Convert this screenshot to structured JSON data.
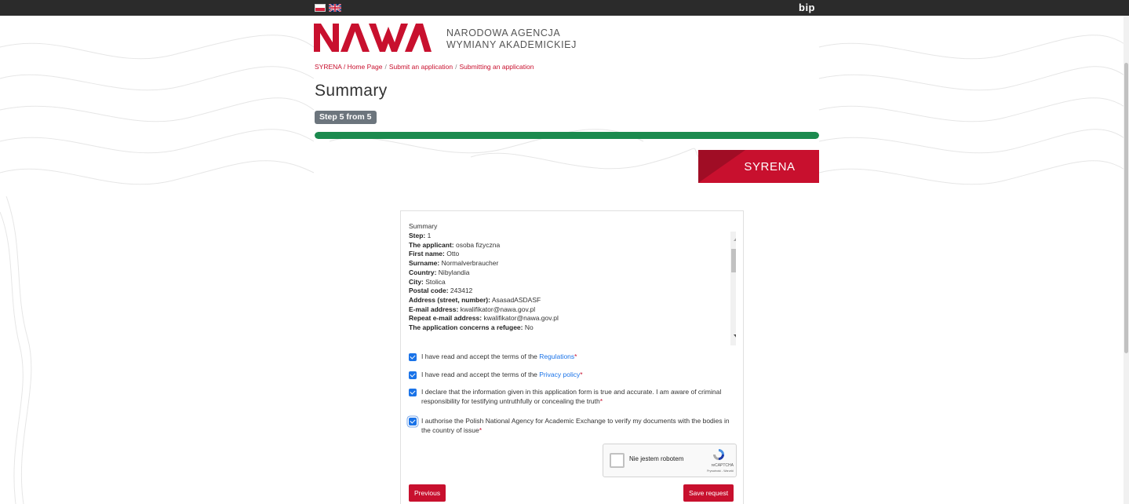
{
  "topbar": {
    "bip_label": "bip",
    "languages": [
      "polish-flag",
      "english-flag"
    ]
  },
  "header": {
    "logo_text": "NAWA",
    "agency_line1": "NARODOWA AGENCJA",
    "agency_line2": "WYMIANY AKADEMICKIEJ",
    "brand_color": "#c8102e"
  },
  "breadcrumb": {
    "items": [
      "SYRENA / Home Page",
      "Submit an application",
      "Submitting an application"
    ]
  },
  "page": {
    "title": "Summary",
    "step_badge": "Step 5 from 5",
    "progress_fraction": 1.0,
    "progress_color": "#1b8a4e",
    "syrena_label": "SYRENA"
  },
  "summary": {
    "heading": "Summary",
    "fields": [
      {
        "label": "Step:",
        "value": "1"
      },
      {
        "label": "The applicant:",
        "value": "osoba fizyczna"
      },
      {
        "label": "First name:",
        "value": "Otto"
      },
      {
        "label": "Surname:",
        "value": "Normalverbraucher"
      },
      {
        "label": "Country:",
        "value": "Nibylandia"
      },
      {
        "label": "City:",
        "value": "Stolica"
      },
      {
        "label": "Postal code:",
        "value": "243412"
      },
      {
        "label": "Address (street, number):",
        "value": "AsasadASDASF"
      },
      {
        "label": "E-mail address:",
        "value": "kwalifikator@nawa.gov.pl"
      },
      {
        "label": "Repeat e-mail address:",
        "value": "kwalifikator@nawa.gov.pl"
      },
      {
        "label": "The application concerns a refugee:",
        "value": "No"
      }
    ]
  },
  "consents": [
    {
      "text": "I have read and accept the terms of the ",
      "link": "Regulations",
      "req": "*",
      "checked": true
    },
    {
      "text": "I have read and accept the terms of the ",
      "link": "Privacy policy",
      "req": "*",
      "checked": true
    },
    {
      "text": "I declare that the information given in this application form is true and accurate. I am aware of criminal responsibility for testifying untruthfully or concealing the truth",
      "link": "",
      "req": "*",
      "checked": true
    },
    {
      "text": "I authorise the Polish National Agency for Academic Exchange to verify my documents with the bodies in the country of issue",
      "link": "",
      "req": "*",
      "checked": true
    }
  ],
  "captcha": {
    "label": "Nie jestem robotem",
    "brand": "reCAPTCHA",
    "privacy": "Prywatność - Warunki"
  },
  "actions": {
    "previous_label": "Previous",
    "save_label": "Save request"
  }
}
